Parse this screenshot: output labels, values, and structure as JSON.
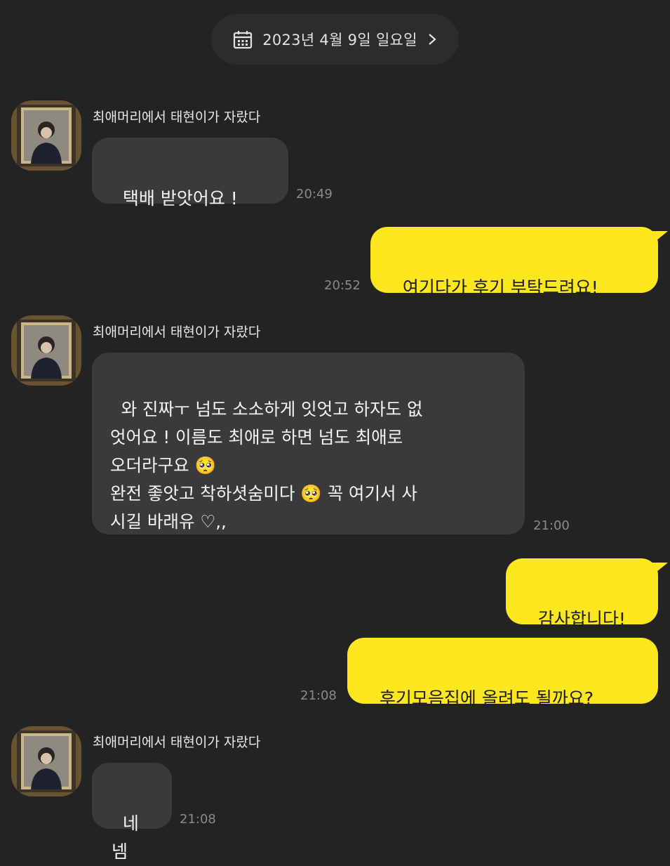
{
  "header": {
    "date": "2023년 4월 9일 일요일"
  },
  "sender_name": "최애머리에서 태현이가 자랐다",
  "messages": [
    {
      "id": "m1",
      "from": "them",
      "text": "택배 받앗어요 !",
      "time": "20:49"
    },
    {
      "id": "m2",
      "from": "me",
      "text": "여기다가 후기 부탁드려요!",
      "time": "20:52"
    },
    {
      "id": "m3",
      "from": "them",
      "text": "와 진짜ㅜ 넘도 소소하게 잇엇고 하자도 없\n엇어요 ! 이름도 최애로 하면 넘도 최애로\n오더라구요 🥺\n완전 좋앗고 착하셧숨미다 🥺 꼭 여기서 사\n시길 바래유 ♡,,",
      "time": "21:00"
    },
    {
      "id": "m4",
      "from": "me",
      "text": "감사합니다!",
      "time": ""
    },
    {
      "id": "m5",
      "from": "me",
      "text": "후기모음집에 올려도 될까요?",
      "time": "21:08"
    },
    {
      "id": "m6",
      "from": "them",
      "text": "네넴",
      "time": "21:08"
    }
  ],
  "colors": {
    "background": "#232323",
    "incoming_bubble": "#3a3a3a",
    "outgoing_bubble": "#fce61e"
  },
  "icons": {
    "date": "calendar-icon",
    "chevron": "chevron-right-icon"
  }
}
